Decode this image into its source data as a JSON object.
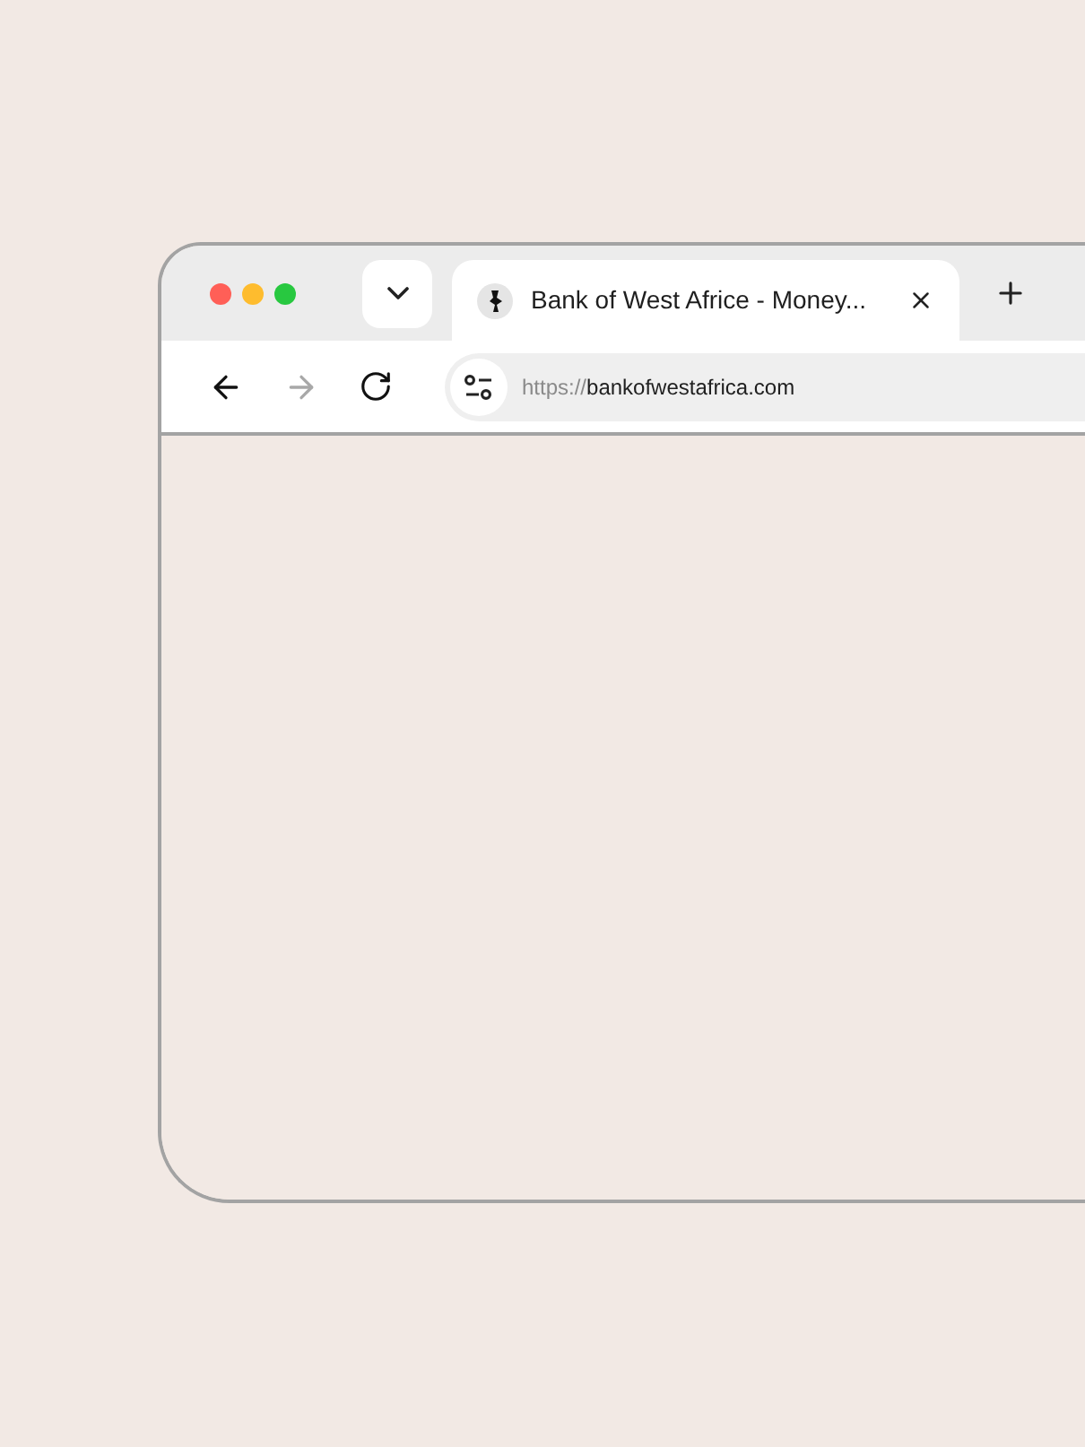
{
  "tabs": [
    {
      "title": "Bank of West Africe - Money...",
      "selected": true
    }
  ],
  "toolbar": {
    "forward_disabled": true
  },
  "address": {
    "scheme": "https://",
    "host": "bankofwestafrica.com"
  }
}
